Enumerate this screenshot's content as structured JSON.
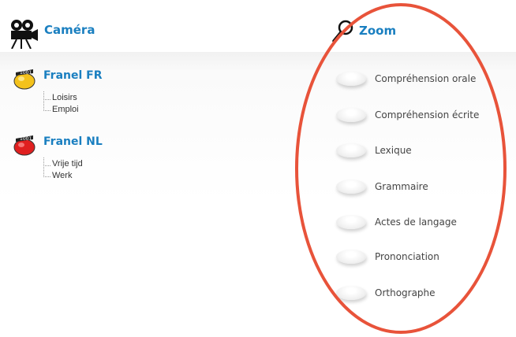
{
  "camera": {
    "title": "Caméra",
    "icon": "movie-camera-icon",
    "groups": [
      {
        "title": "Franel FR",
        "logo": "franel-fr-logo",
        "logo_color": "#f4c21c",
        "items": [
          "Loisirs",
          "Emploi"
        ]
      },
      {
        "title": "Franel NL",
        "logo": "franel-nl-logo",
        "logo_color": "#e02020",
        "items": [
          "Vrije tijd",
          "Werk"
        ]
      }
    ]
  },
  "zoom": {
    "title": "Zoom",
    "icon": "magnifier-icon",
    "items": [
      "Compréhension orale",
      "Compréhension écrite",
      "Lexique",
      "Grammaire",
      "Actes de langage",
      "Prononciation",
      "Orthographe"
    ]
  },
  "colors": {
    "accent": "#1a7fc0",
    "annotation": "#e8533a"
  }
}
